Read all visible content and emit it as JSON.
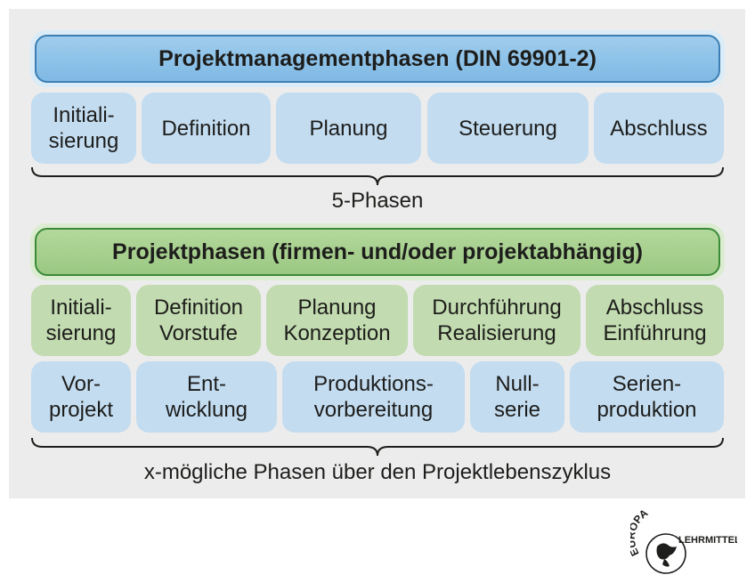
{
  "section1": {
    "header": "Projektmanagementphasen (DIN 69901-2)",
    "phases": [
      "Initiali-\nsierung",
      "Definition",
      "Planung",
      "Steuerung",
      "Abschluss"
    ],
    "caption": "5-Phasen"
  },
  "section2": {
    "header": "Projektphasen (firmen- und/oder projektabhängig)",
    "row1": [
      "Initiali-\nsierung",
      "Definition\nVorstufe",
      "Planung\nKonzeption",
      "Durchführung\nRealisierung",
      "Abschluss\nEinführung"
    ],
    "row2": [
      "Vor-\nprojekt",
      "Ent-\nwicklung",
      "Produktions-\nvorbereitung",
      "Null-\nserie",
      "Serien-\nproduktion"
    ],
    "caption": "x-mögliche Phasen über den Projektlebenszyklus"
  },
  "logo": {
    "top_text": "EUROPA",
    "bottom_text": "LEHRMITTEL"
  },
  "colors": {
    "panel": "#ececec",
    "blue_header": "#8ec3e9",
    "blue_box": "#c3dcf0",
    "green_header": "#a8d08d",
    "green_box": "#c2dbb0"
  }
}
